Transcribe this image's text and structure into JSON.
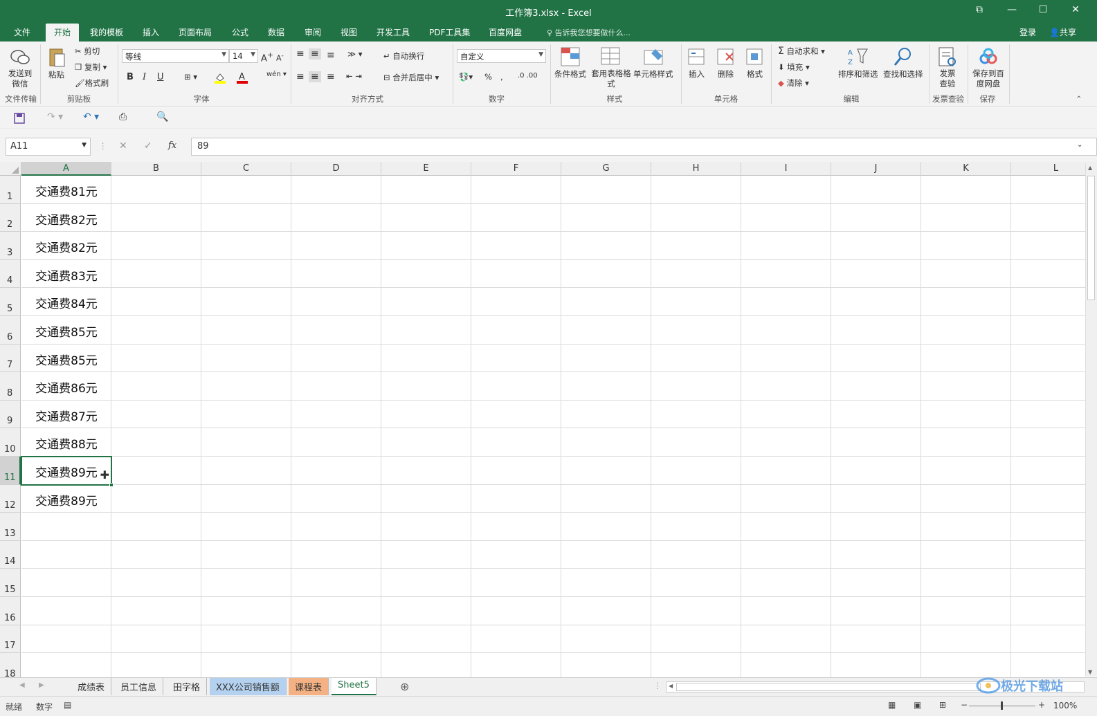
{
  "window": {
    "title": "工作簿3.xlsx - Excel"
  },
  "menu": {
    "tabs": [
      "文件",
      "开始",
      "我的模板",
      "插入",
      "页面布局",
      "公式",
      "数据",
      "审阅",
      "视图",
      "开发工具",
      "PDF工具集",
      "百度网盘"
    ],
    "active_tab": "开始",
    "tell_me": "告诉我您想要做什么...",
    "login": "登录",
    "share": "共享"
  },
  "ribbon": {
    "wechat": {
      "btn": "发送到微信",
      "group": "文件传输"
    },
    "clipboard": {
      "paste": "粘贴",
      "cut": "剪切",
      "copy": "复制",
      "format_painter": "格式刷",
      "group": "剪贴板"
    },
    "font": {
      "name": "等线",
      "size": "14",
      "bold": "B",
      "italic": "I",
      "underline": "U",
      "group": "字体"
    },
    "alignment": {
      "wrap": "自动换行",
      "merge": "合并后居中",
      "group": "对齐方式"
    },
    "number": {
      "format": "自定义",
      "group": "数字"
    },
    "styles": {
      "cond": "条件格式",
      "table": "套用表格格式",
      "cell": "单元格样式",
      "group": "样式"
    },
    "cells": {
      "insert": "插入",
      "delete": "删除",
      "format": "格式",
      "group": "单元格"
    },
    "editing": {
      "autosum": "自动求和",
      "fill": "填充",
      "clear": "清除",
      "sort": "排序和筛选",
      "find": "查找和选择",
      "group": "编辑"
    },
    "invoice": {
      "btn": "发票查验",
      "group": "发票查验"
    },
    "save": {
      "btn": "保存到百度网盘",
      "group": "保存"
    }
  },
  "formula_bar": {
    "name_box": "A11",
    "content": "89"
  },
  "columns": [
    "A",
    "B",
    "C",
    "D",
    "E",
    "F",
    "G",
    "H",
    "I",
    "J",
    "K",
    "L"
  ],
  "rows": [
    "1",
    "2",
    "3",
    "4",
    "5",
    "6",
    "7",
    "8",
    "9",
    "10",
    "11",
    "12",
    "13",
    "14",
    "15",
    "16",
    "17",
    "18"
  ],
  "cells_a": [
    "交通费81元",
    "交通费82元",
    "交通费82元",
    "交通费83元",
    "交通费84元",
    "交通费85元",
    "交通费85元",
    "交通费86元",
    "交通费87元",
    "交通费88元",
    "交通费89元",
    "交通费89元"
  ],
  "selected": {
    "row": 11,
    "col": "A"
  },
  "sheet_tabs": [
    {
      "name": "成绩表",
      "color": ""
    },
    {
      "name": "员工信息",
      "color": ""
    },
    {
      "name": "田字格",
      "color": ""
    },
    {
      "name": "XXX公司销售额",
      "color": "#b4d1ef"
    },
    {
      "name": "课程表",
      "color": "#f4b183"
    },
    {
      "name": "Sheet5",
      "color": "#ffffff",
      "active": true
    }
  ],
  "status": {
    "ready": "就绪",
    "mode": "数字",
    "zoom": "100%"
  },
  "watermark": "极光下载站"
}
